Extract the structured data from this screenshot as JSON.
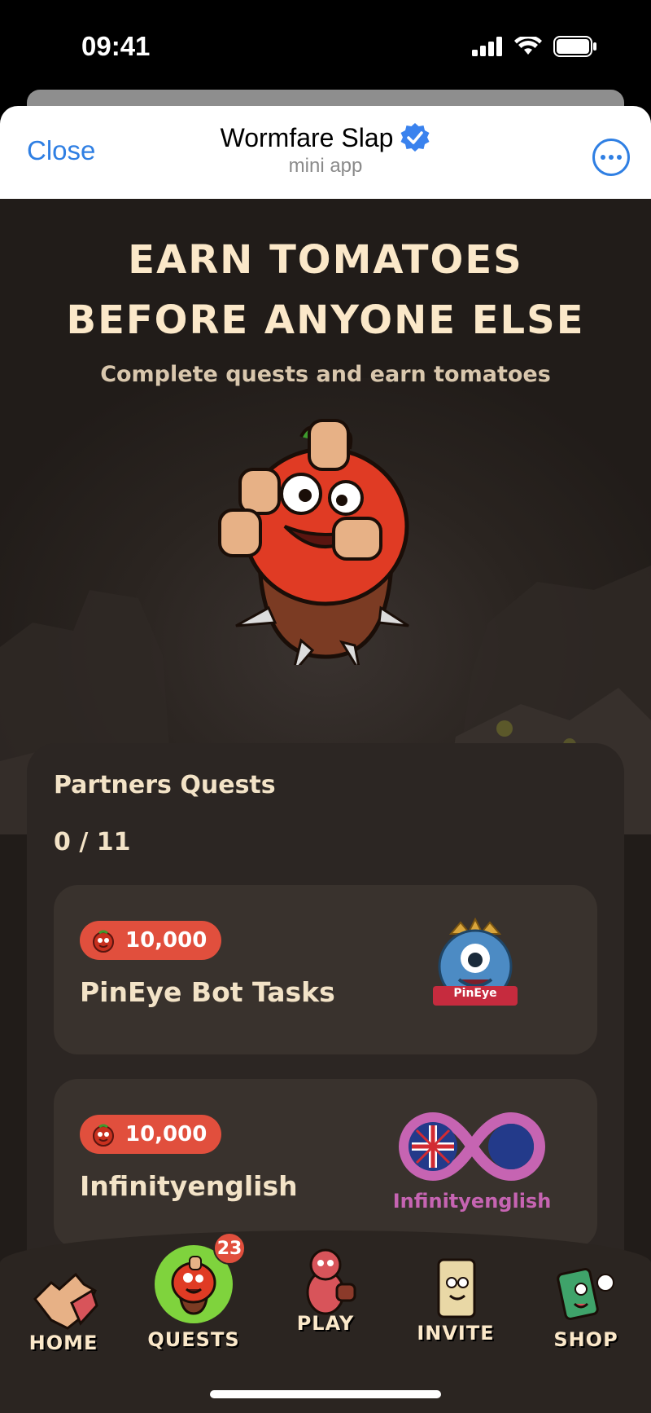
{
  "status": {
    "time": "09:41"
  },
  "header": {
    "close_label": "Close",
    "title": "Wormfare Slap",
    "subtitle": "mini app"
  },
  "hero": {
    "title_line1": "EARN TOMATOES",
    "title_line2": "BEFORE ANYONE ELSE",
    "subtitle": "Complete quests and earn tomatoes"
  },
  "quests": {
    "title": "Partners Quests",
    "progress": "0 / 11",
    "items": [
      {
        "reward": "10,000",
        "name": "PinEye Bot Tasks",
        "logo_text": "PinEye",
        "logo_icon": "pineye-monster-icon"
      },
      {
        "reward": "10,000",
        "name": "Infinityenglish",
        "logo_text": "Infinityenglish",
        "logo_icon": "infinity-uk-flag-icon"
      }
    ]
  },
  "nav": {
    "items": [
      {
        "label": "HOME",
        "icon": "hand-slap-icon"
      },
      {
        "label": "QUESTS",
        "icon": "tomato-quests-icon",
        "badge": "23"
      },
      {
        "label": "PLAY",
        "icon": "worm-fighter-icon"
      },
      {
        "label": "INVITE",
        "icon": "scroll-icon"
      },
      {
        "label": "SHOP",
        "icon": "cash-worm-icon"
      }
    ]
  },
  "colors": {
    "accent": "#2f7fe3",
    "reward_pill": "#e14f3d",
    "bg": "#211c19",
    "cream": "#fbe8c9"
  }
}
